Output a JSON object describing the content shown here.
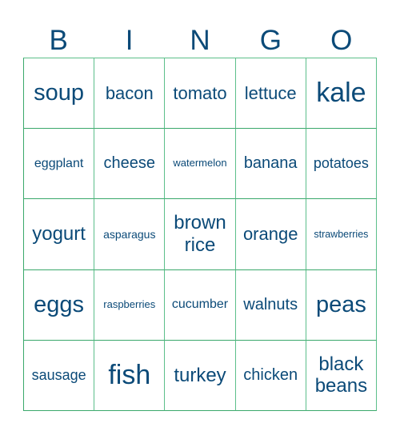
{
  "header": {
    "letters": [
      "B",
      "I",
      "N",
      "G",
      "O"
    ]
  },
  "board": {
    "rows": [
      [
        "soup",
        "bacon",
        "tomato",
        "lettuce",
        "kale"
      ],
      [
        "eggplant",
        "cheese",
        "watermelon",
        "banana",
        "potatoes"
      ],
      [
        "yogurt",
        "asparagus",
        "brown rice",
        "orange",
        "strawberries"
      ],
      [
        "eggs",
        "raspberries",
        "cucumber",
        "walnuts",
        "peas"
      ],
      [
        "sausage",
        "fish",
        "turkey",
        "chicken",
        "black beans"
      ]
    ]
  },
  "colors": {
    "text": "#0b4a78",
    "border": "#3aa86b"
  }
}
